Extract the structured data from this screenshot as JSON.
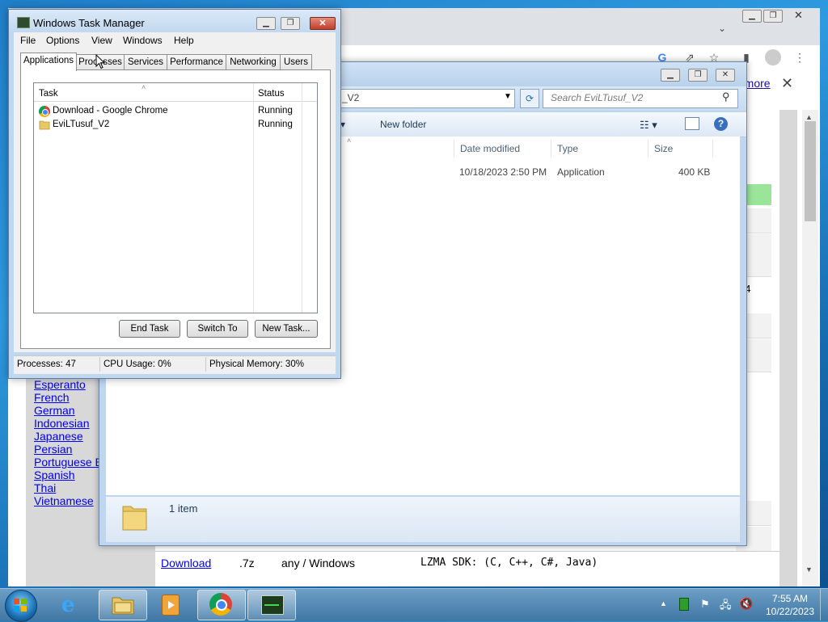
{
  "chrome": {
    "infobar_link": "n more",
    "infobar_close": "✕",
    "side_value": "64",
    "languages": [
      "Esperanto",
      "French",
      "German",
      "Indonesian",
      "Japanese",
      "Persian",
      "Portuguese B",
      "Spanish",
      "Thai",
      "Vietnamese"
    ],
    "download_row": {
      "link": "Download",
      "ext": ".7z",
      "platform": "any / Windows",
      "desc": "LZMA SDK: (C, C++, C#, Java)"
    }
  },
  "explorer": {
    "address_text": "_V2",
    "search_placeholder": "Search EviLTusuf_V2",
    "organize_fragment": "n ▾",
    "new_folder": "New folder",
    "columns": [
      "Date modified",
      "Type",
      "Size"
    ],
    "file": {
      "date": "10/18/2023 2:50 PM",
      "type": "Application",
      "size": "400 KB"
    },
    "status_items": "1 item"
  },
  "taskmanager": {
    "title": "Windows Task Manager",
    "menu": [
      "File",
      "Options",
      "View",
      "Windows",
      "Help"
    ],
    "tabs": [
      "Applications",
      "Processes",
      "Services",
      "Performance",
      "Networking",
      "Users"
    ],
    "active_tab": "Applications",
    "list_headers": {
      "task": "Task",
      "status": "Status"
    },
    "tasks": [
      {
        "name": "Download - Google Chrome",
        "status": "Running",
        "icon": "chrome-icon"
      },
      {
        "name": "EviLTusuf_V2",
        "status": "Running",
        "icon": "folder-icon"
      }
    ],
    "buttons": {
      "end_task": "End Task",
      "switch_to": "Switch To",
      "new_task": "New Task..."
    },
    "status": {
      "processes": "Processes: 47",
      "cpu": "CPU Usage: 0%",
      "memory": "Physical Memory: 30%"
    }
  },
  "taskbar": {
    "time": "7:55 AM",
    "date": "10/22/2023",
    "pinned": [
      "internet-explorer-icon",
      "file-explorer-icon",
      "media-player-icon",
      "chrome-icon",
      "task-manager-icon"
    ]
  },
  "colors": {
    "accent_link": "#0000ee",
    "chrome_link": "#1a0dab",
    "green_row": "#9be59b"
  }
}
